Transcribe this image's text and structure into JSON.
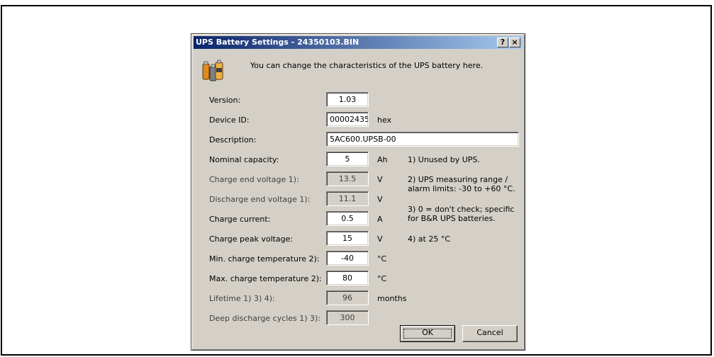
{
  "dialog": {
    "title": "UPS Battery Settings - 24350103.BIN",
    "help_glyph": "?",
    "close_glyph": "×",
    "intro": "You can change the characteristics of the UPS battery here."
  },
  "fields": {
    "version": {
      "label": "Version:",
      "value": "1.03"
    },
    "device_id": {
      "label": "Device ID:",
      "value": "00002435",
      "unit": "hex"
    },
    "description": {
      "label": "Description:",
      "value": "5AC600.UPSB-00"
    },
    "nominal_capacity": {
      "label": "Nominal capacity:",
      "value": "5",
      "unit": "Ah"
    },
    "charge_end_voltage": {
      "label": "Charge end voltage 1):",
      "value": "13.5",
      "unit": "V"
    },
    "discharge_end_voltage": {
      "label": "Discharge end voltage 1):",
      "value": "11.1",
      "unit": "V"
    },
    "charge_current": {
      "label": "Charge current:",
      "value": "0.5",
      "unit": "A"
    },
    "charge_peak_voltage": {
      "label": "Charge peak voltage:",
      "value": "15",
      "unit": "V"
    },
    "min_charge_temperature": {
      "label": "Min. charge temperature 2):",
      "value": "-40",
      "unit": "°C"
    },
    "max_charge_temperature": {
      "label": "Max. charge temperature 2):",
      "value": "80",
      "unit": "°C"
    },
    "lifetime": {
      "label": "Lifetime 1) 3) 4):",
      "value": "96",
      "unit": "months"
    },
    "deep_discharge_cycles": {
      "label": "Deep discharge cycles 1) 3):",
      "value": "300"
    }
  },
  "notes": {
    "n1": "1) Unused by UPS.",
    "n2": "2) UPS measuring range / alarm limits: -30 to +60 °C.",
    "n3": "3) 0 = don't check; specific for B&R UPS batteries.",
    "n4": "4) at 25 °C"
  },
  "buttons": {
    "ok": "OK",
    "cancel": "Cancel"
  },
  "icons": {
    "battery": "battery-icon"
  }
}
